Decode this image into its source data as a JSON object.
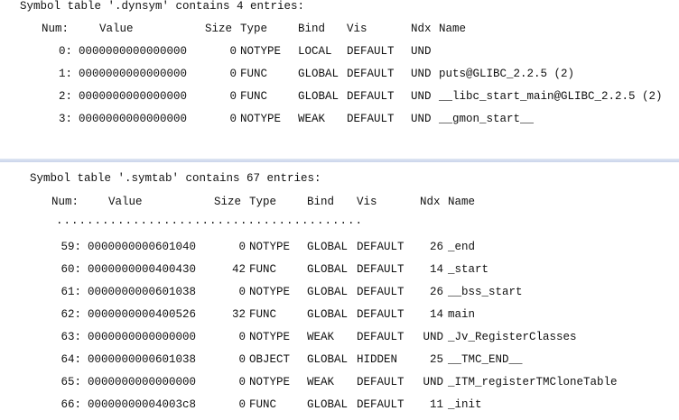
{
  "dynsym": {
    "title": "Symbol table '.dynsym' contains 4 entries:",
    "headers": {
      "num": "Num:",
      "value": "Value",
      "size": "Size",
      "type": "Type",
      "bind": "Bind",
      "vis": "Vis",
      "ndx": "Ndx",
      "name": "Name"
    },
    "rows": [
      {
        "num": "0:",
        "value": "0000000000000000",
        "size": "0",
        "type": "NOTYPE",
        "bind": "LOCAL",
        "vis": "DEFAULT",
        "ndx": "UND",
        "name": ""
      },
      {
        "num": "1:",
        "value": "0000000000000000",
        "size": "0",
        "type": "FUNC",
        "bind": "GLOBAL",
        "vis": "DEFAULT",
        "ndx": "UND",
        "name": "puts@GLIBC_2.2.5 (2)"
      },
      {
        "num": "2:",
        "value": "0000000000000000",
        "size": "0",
        "type": "FUNC",
        "bind": "GLOBAL",
        "vis": "DEFAULT",
        "ndx": "UND",
        "name": "__libc_start_main@GLIBC_2.2.5 (2)"
      },
      {
        "num": "3:",
        "value": "0000000000000000",
        "size": "0",
        "type": "NOTYPE",
        "bind": "WEAK",
        "vis": "DEFAULT",
        "ndx": "UND",
        "name": "__gmon_start__"
      }
    ]
  },
  "symtab": {
    "title": "Symbol table '.symtab' contains 67 entries:",
    "headers": {
      "num": "Num:",
      "value": "Value",
      "size": "Size",
      "type": "Type",
      "bind": "Bind",
      "vis": "Vis",
      "ndx": "Ndx",
      "name": "Name"
    },
    "ellipsis": "........................................",
    "rows": [
      {
        "num": "59:",
        "value": "0000000000601040",
        "size": "0",
        "type": "NOTYPE",
        "bind": "GLOBAL",
        "vis": "DEFAULT",
        "ndx": "26",
        "name": "_end"
      },
      {
        "num": "60:",
        "value": "0000000000400430",
        "size": "42",
        "type": "FUNC",
        "bind": "GLOBAL",
        "vis": "DEFAULT",
        "ndx": "14",
        "name": "_start"
      },
      {
        "num": "61:",
        "value": "0000000000601038",
        "size": "0",
        "type": "NOTYPE",
        "bind": "GLOBAL",
        "vis": "DEFAULT",
        "ndx": "26",
        "name": "__bss_start"
      },
      {
        "num": "62:",
        "value": "0000000000400526",
        "size": "32",
        "type": "FUNC",
        "bind": "GLOBAL",
        "vis": "DEFAULT",
        "ndx": "14",
        "name": "main"
      },
      {
        "num": "63:",
        "value": "0000000000000000",
        "size": "0",
        "type": "NOTYPE",
        "bind": "WEAK",
        "vis": "DEFAULT",
        "ndx": "UND",
        "name": "_Jv_RegisterClasses"
      },
      {
        "num": "64:",
        "value": "0000000000601038",
        "size": "0",
        "type": "OBJECT",
        "bind": "GLOBAL",
        "vis": "HIDDEN",
        "ndx": "25",
        "name": "__TMC_END__"
      },
      {
        "num": "65:",
        "value": "0000000000000000",
        "size": "0",
        "type": "NOTYPE",
        "bind": "WEAK",
        "vis": "DEFAULT",
        "ndx": "UND",
        "name": "_ITM_registerTMCloneTable"
      },
      {
        "num": "66:",
        "value": "00000000004003c8",
        "size": "0",
        "type": "FUNC",
        "bind": "GLOBAL",
        "vis": "DEFAULT",
        "ndx": "11",
        "name": "_init"
      }
    ]
  }
}
